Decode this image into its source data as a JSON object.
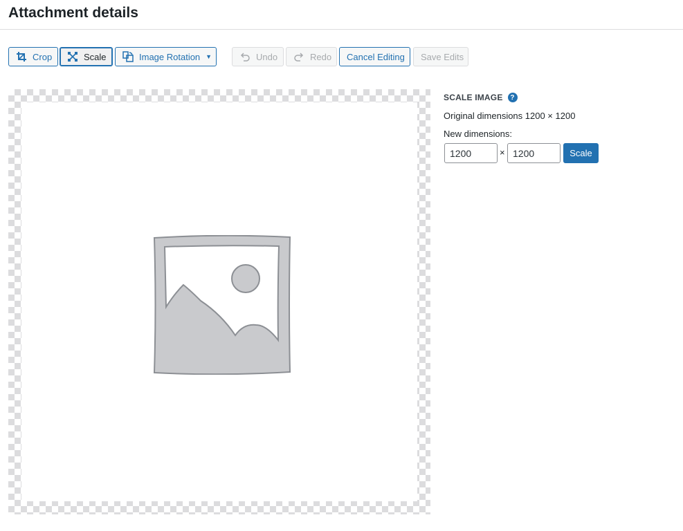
{
  "header": {
    "title": "Attachment details"
  },
  "toolbar": {
    "crop_label": "Crop",
    "scale_label": "Scale",
    "rotation_label": "Image Rotation",
    "undo_label": "Undo",
    "redo_label": "Redo",
    "cancel_label": "Cancel Editing",
    "save_label": "Save Edits"
  },
  "side": {
    "heading": "SCALE IMAGE",
    "help_glyph": "?",
    "original_dims": "Original dimensions 1200 × 1200",
    "new_dims_label": "New dimensions:",
    "width_value": "1200",
    "height_value": "1200",
    "times": "×",
    "scale_button": "Scale"
  },
  "icons": [
    "crop-icon",
    "scale-icon",
    "rotate-icon",
    "undo-icon",
    "redo-icon",
    "help-icon",
    "image-placeholder-icon"
  ],
  "colors": {
    "accent": "#2271b1",
    "disabled": "#a7aaad",
    "border": "#dcdcde"
  }
}
